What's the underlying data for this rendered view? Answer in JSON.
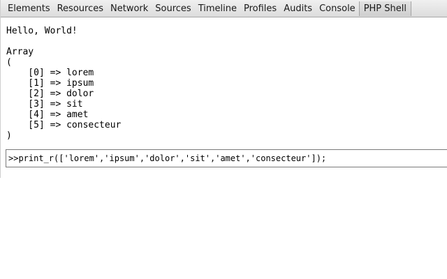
{
  "tabs": [
    {
      "label": "Elements"
    },
    {
      "label": "Resources"
    },
    {
      "label": "Network"
    },
    {
      "label": "Sources"
    },
    {
      "label": "Timeline"
    },
    {
      "label": "Profiles"
    },
    {
      "label": "Audits"
    },
    {
      "label": "Console"
    },
    {
      "label": "PHP Shell",
      "active": true
    }
  ],
  "output": {
    "lines": [
      "Hello, World!",
      "",
      "Array",
      "(",
      "    [0] => lorem",
      "    [1] => ipsum",
      "    [2] => dolor",
      "    [3] => sit",
      "    [4] => amet",
      "    [5] => consecteur",
      ")"
    ]
  },
  "prompt": {
    "symbol": ">>",
    "value": "print_r(['lorem','ipsum','dolor','sit','amet','consecteur']);"
  }
}
